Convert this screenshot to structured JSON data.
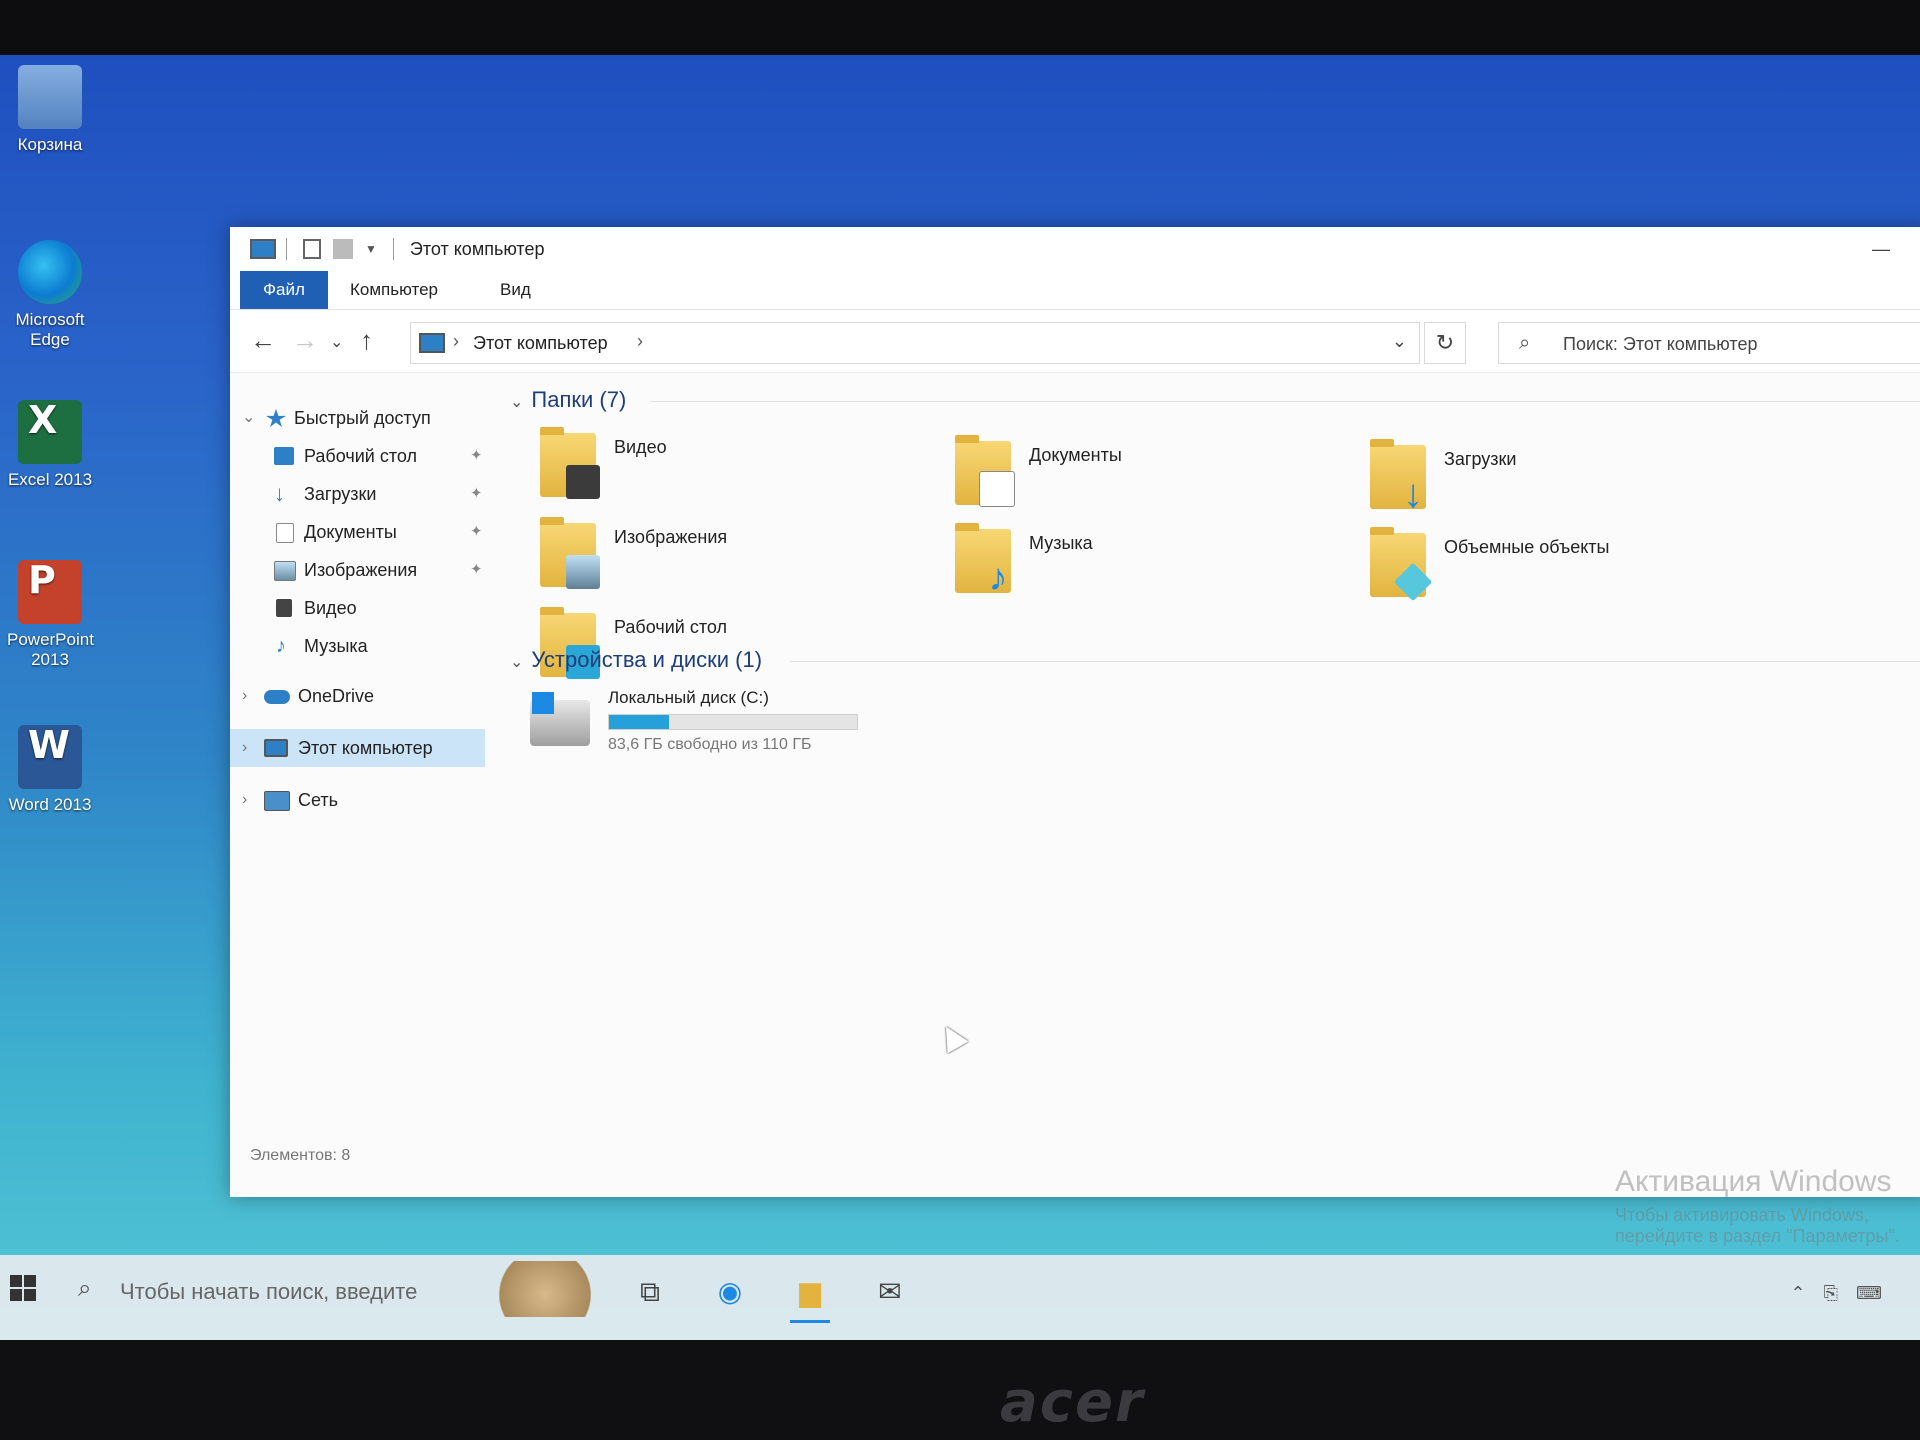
{
  "desktop": {
    "icons": [
      {
        "label": "Корзина",
        "icon": "recycle-bin-icon"
      },
      {
        "label": "Microsoft Edge",
        "icon": "edge-icon"
      },
      {
        "label": "Excel 2013",
        "icon": "excel-icon",
        "letter": "X"
      },
      {
        "label": "PowerPoint 2013",
        "icon": "powerpoint-icon",
        "letter": "P"
      },
      {
        "label": "Word 2013",
        "icon": "word-icon",
        "letter": "W"
      }
    ],
    "watermark": {
      "title": "Активация Windows",
      "subtitle": "Чтобы активировать Windows, перейдите в раздел \"Параметры\"."
    }
  },
  "window": {
    "title": "Этот компьютер",
    "ribbon_tabs": [
      "Файл",
      "Компьютер",
      "Вид"
    ],
    "address": {
      "path": "Этот компьютер"
    },
    "search_placeholder": "Поиск: Этот компьютер",
    "sidebar": [
      {
        "label": "Быстрый доступ",
        "icon": "star-icon",
        "level": 0,
        "expanded": true
      },
      {
        "label": "Рабочий стол",
        "icon": "desktop-icon",
        "level": 1,
        "pinned": true
      },
      {
        "label": "Загрузки",
        "icon": "download-icon",
        "level": 1,
        "pinned": true
      },
      {
        "label": "Документы",
        "icon": "document-icon",
        "level": 1,
        "pinned": true
      },
      {
        "label": "Изображения",
        "icon": "image-icon",
        "level": 1,
        "pinned": true
      },
      {
        "label": "Видео",
        "icon": "video-icon",
        "level": 1
      },
      {
        "label": "Музыка",
        "icon": "music-icon",
        "level": 1
      },
      {
        "label": "OneDrive",
        "icon": "cloud-icon",
        "level": 0
      },
      {
        "label": "Этот компьютер",
        "icon": "computer-icon",
        "level": 0,
        "selected": true
      },
      {
        "label": "Сеть",
        "icon": "network-icon",
        "level": 0
      }
    ],
    "folders_group": "Папки (7)",
    "folders": [
      {
        "label": "Видео",
        "icon": "video-folder-icon"
      },
      {
        "label": "Документы",
        "icon": "documents-folder-icon"
      },
      {
        "label": "Загрузки",
        "icon": "downloads-folder-icon"
      },
      {
        "label": "Изображения",
        "icon": "pictures-folder-icon"
      },
      {
        "label": "Музыка",
        "icon": "music-folder-icon"
      },
      {
        "label": "Объемные объекты",
        "icon": "3d-objects-folder-icon"
      },
      {
        "label": "Рабочий стол",
        "icon": "desktop-folder-icon"
      }
    ],
    "devices_group": "Устройства и диски (1)",
    "drives": [
      {
        "label": "Локальный диск (C:)",
        "free_text": "83,6 ГБ свободно из 110 ГБ",
        "used_fraction": 0.24
      }
    ],
    "status": "Элементов: 8"
  },
  "taskbar": {
    "search_placeholder": "Чтобы начать поиск, введите",
    "buttons": [
      "task-view-icon",
      "edge-icon",
      "file-explorer-icon",
      "mail-icon"
    ]
  },
  "bezel": {
    "brand": "acer"
  },
  "colors": {
    "accent": "#1f5fb4",
    "selection": "#cce4f7",
    "drive_bar": "#26a0da"
  }
}
